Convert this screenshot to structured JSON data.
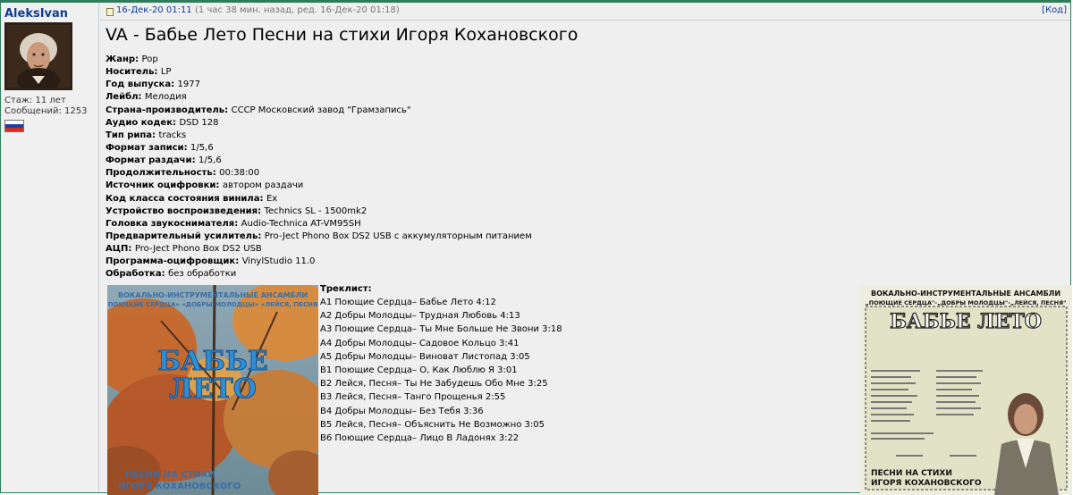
{
  "user": {
    "name": "AleksIvan",
    "stat_age": "Стаж: 11 лет",
    "stat_posts": "Сообщений: 1253",
    "flag_colors": [
      "#ffffff",
      "#1c3fae",
      "#d52b1e"
    ]
  },
  "post": {
    "date": "16-Дек-20 01:11",
    "meta": "(1 час 38 мин. назад, ред. 16-Дек-20 01:18)",
    "quote_button": "[Код]",
    "title": "VA - Бабье Лето Песни на стихи Игоря Кохановского",
    "fields": [
      {
        "label": "Жанр",
        "value": "Pop"
      },
      {
        "label": "Носитель",
        "value": "LP"
      },
      {
        "label": "Год выпуска",
        "value": "1977"
      },
      {
        "label": "Лейбл",
        "value": "Мелодия"
      },
      {
        "label": "Страна-производитель",
        "value": "СССР Московский завод \"Грамзапись\""
      },
      {
        "label": "Аудио кодек",
        "value": "DSD 128"
      },
      {
        "label": "Тип рипа",
        "value": "tracks"
      },
      {
        "label": "Формат записи",
        "value": "1/5,6"
      },
      {
        "label": "Формат раздачи",
        "value": "1/5,6"
      },
      {
        "label": "Продолжительность",
        "value": "00:38:00"
      },
      {
        "label": "Источник оцифровки",
        "value": "автором раздачи"
      },
      {
        "label": "Код класса состояния винила",
        "value": "Ex"
      },
      {
        "label": "Устройство воспроизведения",
        "value": "Technics SL - 1500mk2"
      },
      {
        "label": "Головка звукоснимателя",
        "value": "Audio-Technica AT-VM95SH"
      },
      {
        "label": "Предварительный усилитель",
        "value": "Pro-Ject Phono Box DS2 USB с аккумуляторным питанием"
      },
      {
        "label": "АЦП",
        "value": "Pro-Ject Phono Box DS2 USB"
      },
      {
        "label": "Программа-оцифровщик",
        "value": "VinylStudio 11.0"
      },
      {
        "label": "Обработка",
        "value": "без обработки"
      }
    ],
    "tracklist_header": "Треклист:",
    "tracks": [
      "A1 Поющие Сердца– Бабье Лето 4:12",
      "A2 Добры Молодцы– Трудная Любовь 4:13",
      "A3 Поющие Сердца– Ты Мне Больше Не Звони 3:18",
      "A4 Добры Молодцы– Садовое Кольцо 3:41",
      "A5 Добры Молодцы– Виноват Листопад 3:05",
      "B1 Поющие Сердца– О, Как Люблю Я 3:01",
      "B2 Лейся, Песня– Ты Не Забудешь Обо Мне 3:25",
      "B3 Лейся, Песня– Танго Прощенья 2:55",
      "B4 Добры Молодцы– Без Тебя 3:36",
      "B5 Лейся, Песня– Объяснить Не Возможно 3:05",
      "B6 Поющие Сердца– Лицо В Ладонях 3:22"
    ],
    "cover_front": {
      "top_text": "ВОКАЛЬНО-ИНСТРУМЕНТАЛЬНЫЕ АНСАМБЛИ",
      "top_text2": "«ПОЮЩИЕ СЕРДЦА» «ДОБРЫ МОЛОДЦЫ» «ЛЕЙСЯ, ПЕСНЯ»",
      "title1": "БАБЬЕ",
      "title2": "ЛЕТО",
      "bottom1": "ПЕСНИ НА СТИХИ",
      "bottom2": "ИГОРЯ КОХАНОВСКОГО"
    },
    "cover_back": {
      "top_text": "ВОКАЛЬНО-ИНСТРУМЕНТАЛЬНЫЕ АНСАМБЛИ",
      "top_text2": "„ПОЮЩИЕ СЕРДЦА\"-„ДОБРЫ МОЛОДЦЫ\"-„ЛЕЙСЯ, ПЕСНЯ\"",
      "title": "БАБЬЕ ЛЕТО",
      "bottom1": "ПЕСНИ НА СТИХИ",
      "bottom2": "ИГОРЯ КОХАНОВСКОГО"
    }
  }
}
